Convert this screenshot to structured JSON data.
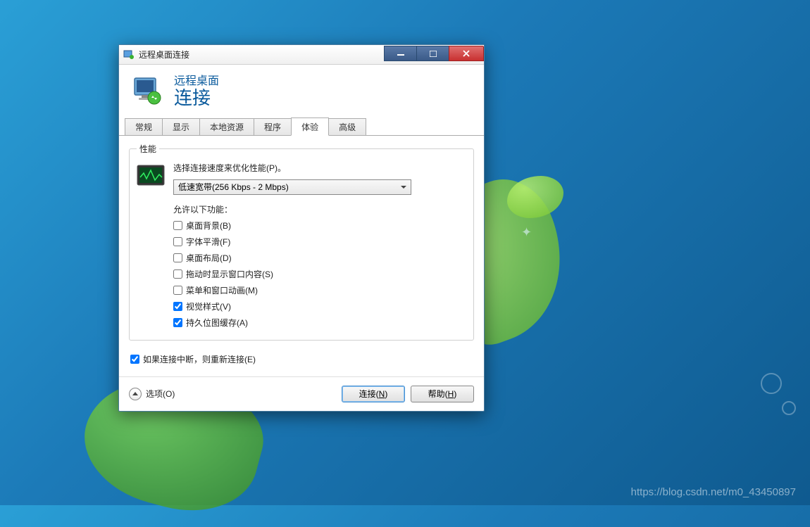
{
  "window": {
    "title": "远程桌面连接"
  },
  "header": {
    "line1": "远程桌面",
    "line2": "连接"
  },
  "tabs": [
    {
      "label": "常规"
    },
    {
      "label": "显示"
    },
    {
      "label": "本地资源"
    },
    {
      "label": "程序"
    },
    {
      "label": "体验"
    },
    {
      "label": "高级"
    }
  ],
  "active_tab_index": 4,
  "performance": {
    "legend": "性能",
    "description": "选择连接速度来优化性能(P)。",
    "speed_value": "低速宽带(256 Kbps - 2 Mbps)",
    "allow_label": "允许以下功能：",
    "checkboxes": [
      {
        "label": "桌面背景(B)",
        "checked": false
      },
      {
        "label": "字体平滑(F)",
        "checked": false
      },
      {
        "label": "桌面布局(D)",
        "checked": false
      },
      {
        "label": "拖动时显示窗口内容(S)",
        "checked": false
      },
      {
        "label": "菜单和窗口动画(M)",
        "checked": false
      },
      {
        "label": "视觉样式(V)",
        "checked": true
      },
      {
        "label": "持久位图缓存(A)",
        "checked": true
      }
    ]
  },
  "reconnect": {
    "label": "如果连接中断，则重新连接(E)",
    "checked": true
  },
  "footer": {
    "options": "选项(O)",
    "connect": "连接",
    "connect_key": "N",
    "help": "帮助",
    "help_key": "H"
  },
  "watermark": "https://blog.csdn.net/m0_43450897"
}
